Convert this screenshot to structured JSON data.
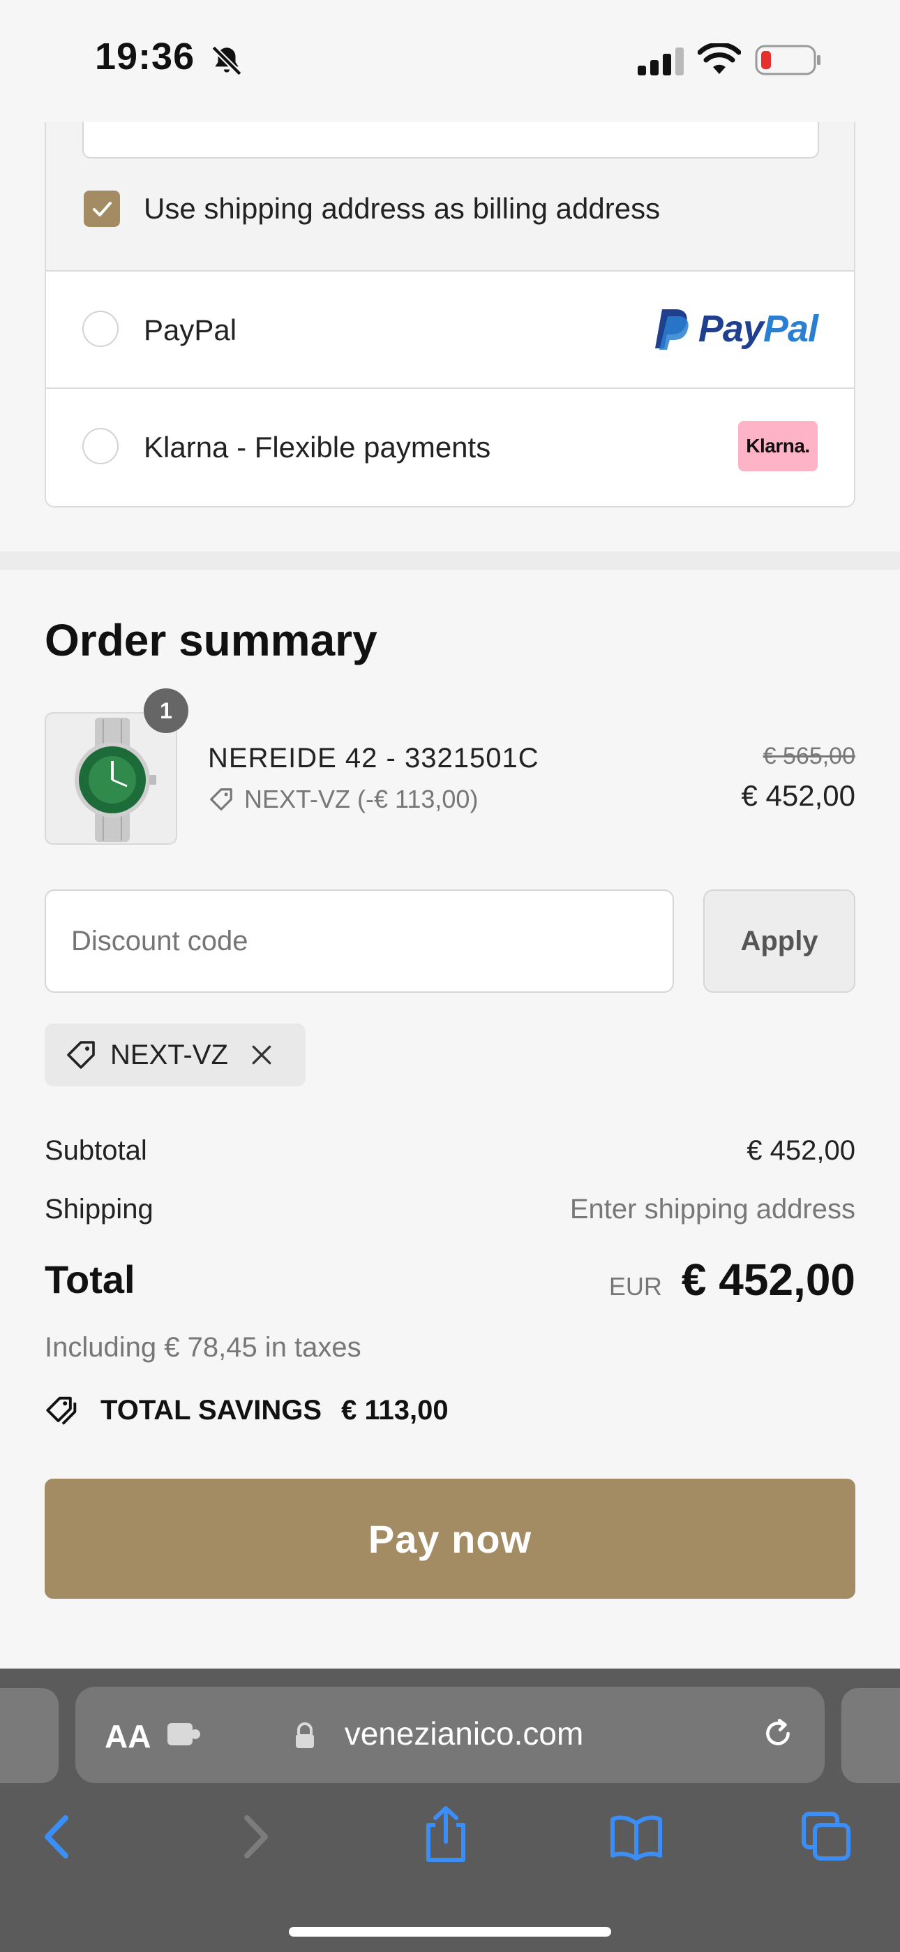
{
  "status_bar": {
    "time": "19:36"
  },
  "payment": {
    "billing_checkbox_label": "Use shipping address as billing address",
    "options": [
      {
        "label": "PayPal",
        "logo": "PayPal"
      },
      {
        "label": "Klarna - Flexible payments",
        "logo": "Klarna."
      }
    ]
  },
  "order": {
    "title": "Order summary",
    "item": {
      "quantity": "1",
      "name": "NEREIDE 42 - 3321501C",
      "discount": "NEXT-VZ (-€ 113,00)",
      "old_price": "€ 565,00",
      "price": "€ 452,00"
    },
    "discount_input": {
      "placeholder": "Discount code"
    },
    "apply_label": "Apply",
    "applied_code": "NEXT-VZ",
    "subtotal_label": "Subtotal",
    "subtotal_value": "€ 452,00",
    "shipping_label": "Shipping",
    "shipping_value": "Enter shipping address",
    "total_label": "Total",
    "total_currency": "EUR",
    "total_value": "€ 452,00",
    "taxes": "Including € 78,45 in taxes",
    "savings_label": "TOTAL SAVINGS",
    "savings_value": "€ 113,00",
    "pay_label": "Pay now"
  },
  "browser": {
    "aa": "AA",
    "url": "venezianico.com"
  },
  "colors": {
    "accent": "#a38c63",
    "link_blue": "#2a7fd1"
  }
}
